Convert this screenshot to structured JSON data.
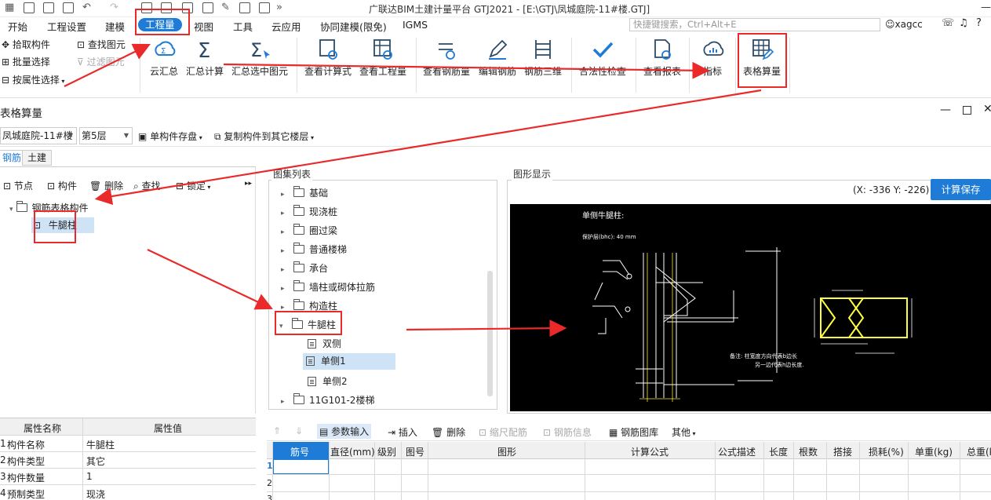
{
  "app": {
    "title": "广联达BIM土建计量平台 GTJ2021 - [E:\\GTJ\\凤城庭院-11#楼.GTJ]",
    "user": "xagcc"
  },
  "menu": [
    "开始",
    "工程设置",
    "建模",
    "工程量",
    "视图",
    "工具",
    "云应用",
    "协同建模(限免)",
    "IGMS"
  ],
  "search_placeholder": "快捷键搜索，Ctrl+Alt+E",
  "ribbon": {
    "small": [
      "拾取构件",
      "批量选择",
      "按属性选择",
      "查找图元",
      "过滤图元"
    ],
    "big": [
      "云汇总",
      "汇总计算",
      "汇总选中图元",
      "查看计算式",
      "查看工程量",
      "查看钢筋量",
      "编辑钢筋",
      "钢筋三维",
      "合法性检查",
      "查看报表",
      "指标",
      "表格算量"
    ]
  },
  "dialog": {
    "title": "表格算量",
    "building": "凤城庭院-11#楼",
    "floor": "第5层",
    "save_single": "单构件存盘",
    "copy_to_floor": "复制构件到其它楼层",
    "tabs": [
      "钢筋",
      "土建"
    ]
  },
  "left_toolbar": [
    "节点",
    "构件",
    "删除",
    "查找",
    "锁定"
  ],
  "left_tree": {
    "root": "钢筋表格构件",
    "child": "牛腿柱"
  },
  "property_grid": {
    "headers": [
      "属性名称",
      "属性值"
    ],
    "rows": [
      {
        "idx": "1",
        "name": "构件名称",
        "value": "牛腿柱"
      },
      {
        "idx": "2",
        "name": "构件类型",
        "value": "其它"
      },
      {
        "idx": "3",
        "name": "构件数量",
        "value": "1"
      },
      {
        "idx": "4",
        "name": "预制类型",
        "value": "现浇"
      }
    ]
  },
  "atlas": {
    "title": "图集列表",
    "nodes": [
      "基础",
      "现浇桩",
      "圈过梁",
      "普通楼梯",
      "承台",
      "墙柱或砌体拉筋",
      "构造柱",
      "牛腿柱"
    ],
    "children": [
      "双侧",
      "单侧1",
      "单侧2"
    ],
    "last": "11G101-2楼梯"
  },
  "graph": {
    "title": "图形显示",
    "coords": "(X: -336 Y: -226)",
    "button": "计算保存",
    "drawing_title": "单侧牛腿柱:",
    "cover": "保护层(bhc): 40  mm",
    "note_line1": "备注: 柱宽度方向代表b边长",
    "note_line2": "另一边代表h边长度."
  },
  "bottom_toolbar": [
    "参数输入",
    "插入",
    "删除",
    "缩尺配筋",
    "钢筋信息",
    "钢筋图库",
    "其他"
  ],
  "table": {
    "headers": [
      "筋号",
      "直径(mm)",
      "级别",
      "图号",
      "图形",
      "计算公式",
      "公式描述",
      "长度",
      "根数",
      "搭接",
      "损耗(%)",
      "单重(kg)",
      "总重(kg)"
    ],
    "rows": [
      "1",
      "2",
      "3"
    ]
  },
  "colors": {
    "accent": "#1e7bd6",
    "annotation": "#ea2a2a",
    "drawing_bg": "#000000",
    "drawing_shape": "#ffff40"
  }
}
